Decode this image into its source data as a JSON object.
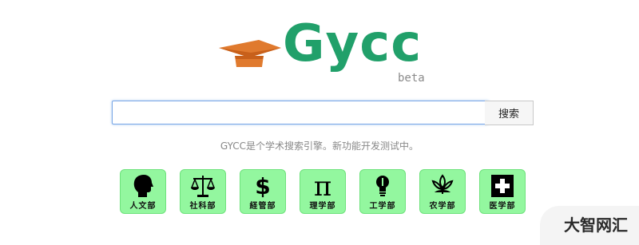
{
  "logo": {
    "text": "Gycc",
    "subtext": "beta",
    "icon": "graduation-cap-icon",
    "text_color": "#21a06a",
    "cap_color": "#e07a2e"
  },
  "search": {
    "value": "",
    "placeholder": "",
    "button_label": "搜索"
  },
  "tagline": "GYCC是个学术搜索引擎。新功能开发测试中。",
  "departments": [
    {
      "label": "人文部",
      "icon": "human-head-icon"
    },
    {
      "label": "社科部",
      "icon": "balance-scale-icon"
    },
    {
      "label": "経管部",
      "icon": "dollar-sign-icon"
    },
    {
      "label": "理学部",
      "icon": "pi-icon"
    },
    {
      "label": "工学部",
      "icon": "lightbulb-icon"
    },
    {
      "label": "农学部",
      "icon": "plant-icon"
    },
    {
      "label": "医学部",
      "icon": "medical-cross-icon"
    }
  ],
  "dept_tile_color": "#93f79f",
  "watermark": "大智网汇"
}
